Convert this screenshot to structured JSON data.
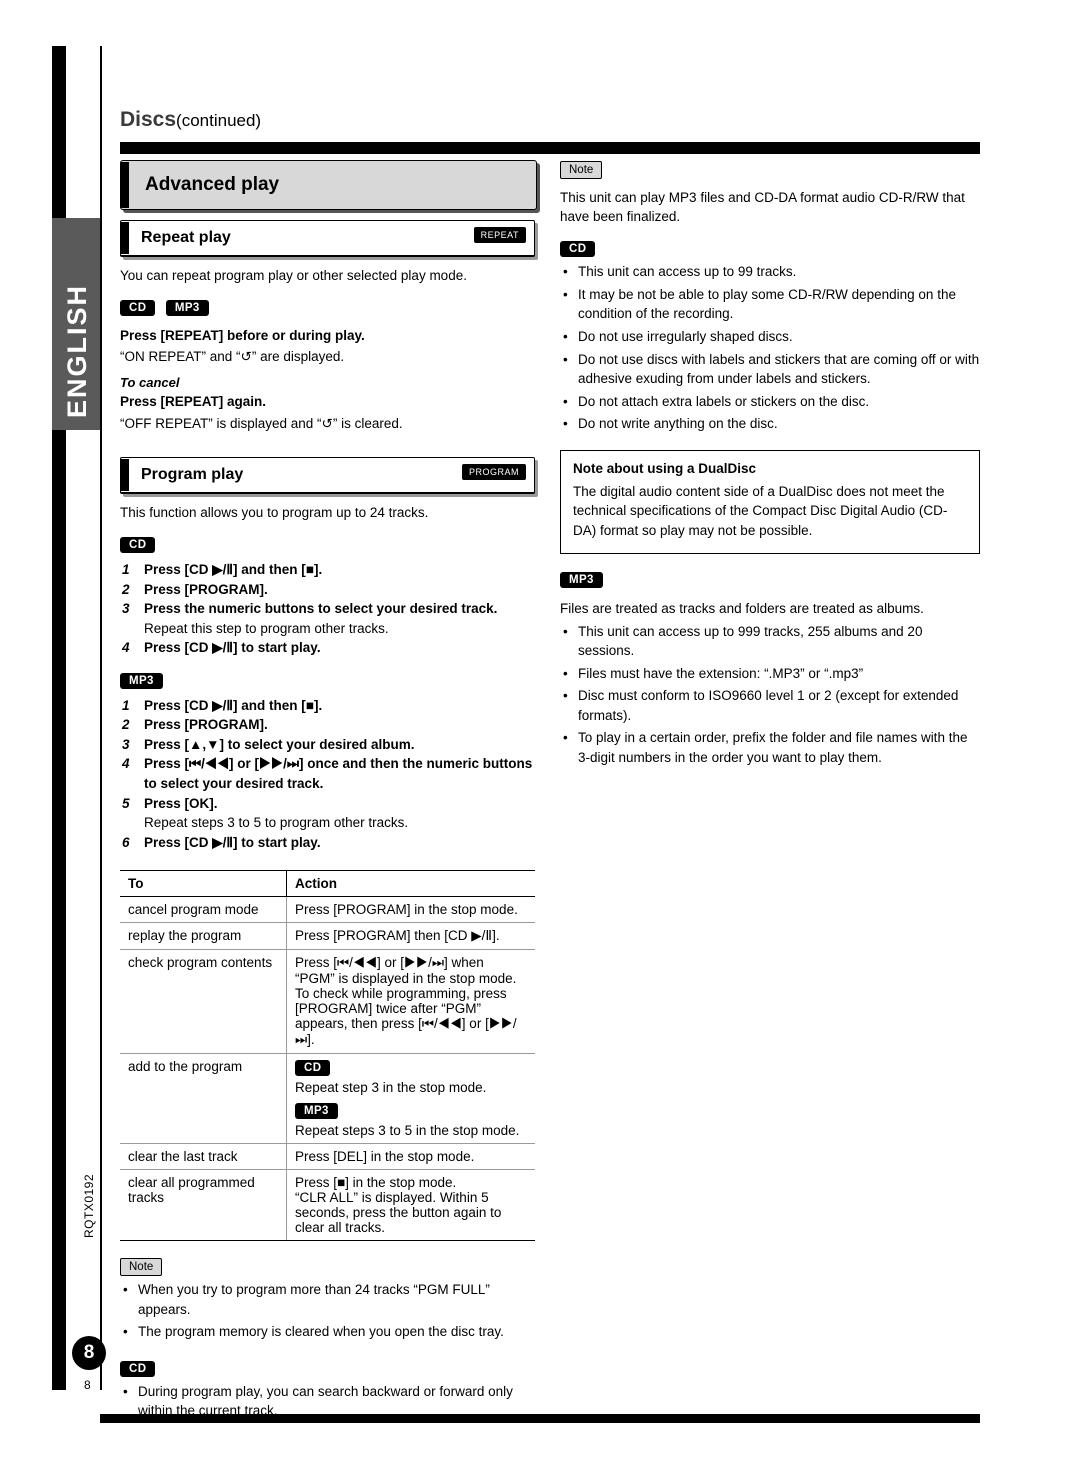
{
  "page": {
    "number": "8",
    "doc_code": "RQTX0192",
    "side_tab": "ENGLISH",
    "header_title": "Discs",
    "header_continued": "(continued)"
  },
  "left": {
    "advanced_play": {
      "title": "Advanced play"
    },
    "repeat": {
      "title": "Repeat play",
      "chip": "REPEAT",
      "intro": "You can repeat program play or other selected play mode.",
      "badges": [
        "CD",
        "MP3"
      ],
      "step1": "Press [REPEAT] before or during play.",
      "step1_sub": "“ON REPEAT” and “↺” are displayed.",
      "cancel_label": "To cancel",
      "cancel_step": "Press [REPEAT] again.",
      "cancel_sub": "“OFF REPEAT” is displayed and “↺” is cleared."
    },
    "program": {
      "title": "Program play",
      "chip": "PROGRAM",
      "intro": "This function allows you to program up to 24 tracks.",
      "cd_badge": "CD",
      "cd_steps": [
        {
          "n": "1",
          "text": "Press [CD ▶/Ⅱ] and then [■]."
        },
        {
          "n": "2",
          "text": "Press [PROGRAM]."
        },
        {
          "n": "3",
          "text": "Press the numeric buttons to select your desired track.",
          "sub": "Repeat this step to program other tracks."
        },
        {
          "n": "4",
          "text": "Press [CD ▶/Ⅱ] to start play."
        }
      ],
      "mp3_badge": "MP3",
      "mp3_steps": [
        {
          "n": "1",
          "text": "Press [CD ▶/Ⅱ] and then [■]."
        },
        {
          "n": "2",
          "text": "Press [PROGRAM]."
        },
        {
          "n": "3",
          "text": "Press [▲,▼] to select your desired album."
        },
        {
          "n": "4",
          "text": "Press [⏮/◀◀] or [▶▶/⏭] once and then the numeric buttons to select your desired track."
        },
        {
          "n": "5",
          "text": "Press [OK].",
          "sub": "Repeat steps 3 to 5 to program other tracks."
        },
        {
          "n": "6",
          "text": "Press [CD ▶/Ⅱ] to start play."
        }
      ]
    },
    "table": {
      "headers": [
        "To",
        "Action"
      ],
      "rows": [
        {
          "to": "cancel program mode",
          "action": "Press [PROGRAM] in the stop mode."
        },
        {
          "to": "replay the program",
          "action": "Press [PROGRAM] then [CD ▶/Ⅱ]."
        },
        {
          "to": "check program contents",
          "action": "Press [⏮/◀◀] or [▶▶/⏭] when “PGM” is displayed in the stop mode.\nTo check while programming, press [PROGRAM] twice after “PGM” appears, then press [⏮/◀◀] or [▶▶/⏭]."
        },
        {
          "to": "add to the program",
          "action_cd_badge": "CD",
          "action_cd": "Repeat step 3 in the stop mode.",
          "action_mp3_badge": "MP3",
          "action_mp3": "Repeat steps 3 to 5 in the stop mode."
        },
        {
          "to": "clear the last track",
          "action": "Press [DEL] in the stop mode."
        },
        {
          "to": "clear all programmed tracks",
          "action": "Press [■] in the stop mode.\n“CLR ALL” is displayed. Within 5 seconds, press the button again to clear all tracks."
        }
      ]
    },
    "notes": {
      "label": "Note",
      "items": [
        "When you try to program more than 24 tracks “PGM FULL” appears.",
        "The program memory is cleared when you open the disc tray."
      ],
      "cd_badge": "CD",
      "cd_items": [
        "During program play, you can search backward or forward only within the current track."
      ]
    }
  },
  "right": {
    "note_label": "Note",
    "note_intro": "This unit can play MP3 files and CD-DA format audio CD-R/RW that have been finalized.",
    "cd_badge": "CD",
    "cd_items": [
      "This unit can access up to 99 tracks.",
      "It may be not be able to play some CD-R/RW depending on the condition of the recording.",
      "Do not use irregularly shaped discs.",
      "Do not use discs with labels and stickers that are coming off or with adhesive exuding from under labels and stickers.",
      "Do not attach extra labels or stickers on the disc.",
      "Do not write anything on the disc."
    ],
    "dualdisc": {
      "title": "Note about using a DualDisc",
      "text": "The digital audio content side of a DualDisc does not meet the technical specifications of the Compact Disc Digital Audio (CD-DA) format so play may not be possible."
    },
    "mp3_badge": "MP3",
    "mp3_intro": "Files are treated as tracks and folders are treated as albums.",
    "mp3_items": [
      "This unit can access up to 999 tracks, 255 albums and 20 sessions.",
      "Files must have the extension: “.MP3” or “.mp3”",
      "Disc must conform to ISO9660 level 1 or 2 (except for extended formats).",
      "To play in a certain order, prefix the folder and file names with the 3-digit numbers in the order you want to play them."
    ]
  }
}
